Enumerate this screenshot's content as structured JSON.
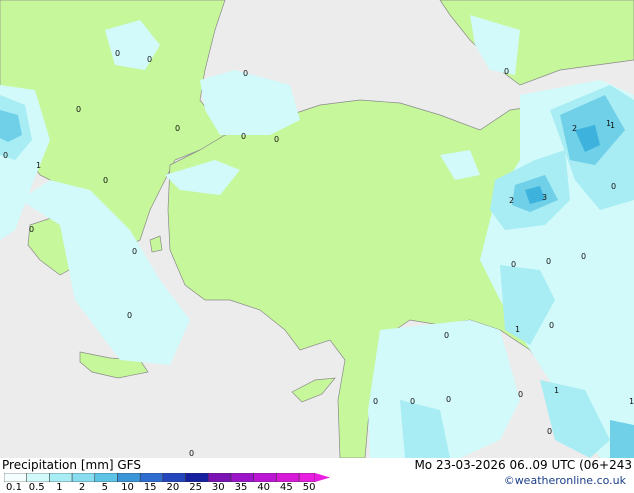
{
  "header": {},
  "map": {
    "colors": {
      "sea": "#ececec",
      "land_dry": "#c6f79a",
      "precip_light": "#d2fafa",
      "precip_mid": "#a8ecf4",
      "precip_high": "#6fd0e8",
      "precip_max": "#3cb2dc",
      "coast": "#8a8a8a"
    },
    "value_labels": [
      "0",
      "0",
      "0",
      "0",
      "1",
      "0",
      "1",
      "0",
      "0",
      "0",
      "0",
      "0",
      "0",
      "0",
      "0",
      "1",
      "2",
      "3",
      "2",
      "0",
      "0",
      "0",
      "0",
      "1",
      "0",
      "0",
      "0",
      "0",
      "0",
      "0",
      "1",
      "0",
      "1",
      "0"
    ]
  },
  "footer": {
    "title": "Precipitation [mm] GFS",
    "date": "Mo 23-03-2026 06..09 UTC (06+243",
    "credit": "©weatheronline.co.uk",
    "legend_ticks": [
      "0.1",
      "0.5",
      "1",
      "2",
      "5",
      "10",
      "15",
      "20",
      "25",
      "30",
      "35",
      "40",
      "45",
      "50"
    ],
    "legend_colors": [
      "#f4fefe",
      "#d2fafa",
      "#a8ecf4",
      "#88dcf0",
      "#5ec4e6",
      "#3a96d8",
      "#2f6ed0",
      "#2346bc",
      "#161f9e",
      "#7a12b4",
      "#9c14c8",
      "#bc16d4",
      "#d81ad8",
      "#e81ee0"
    ]
  }
}
